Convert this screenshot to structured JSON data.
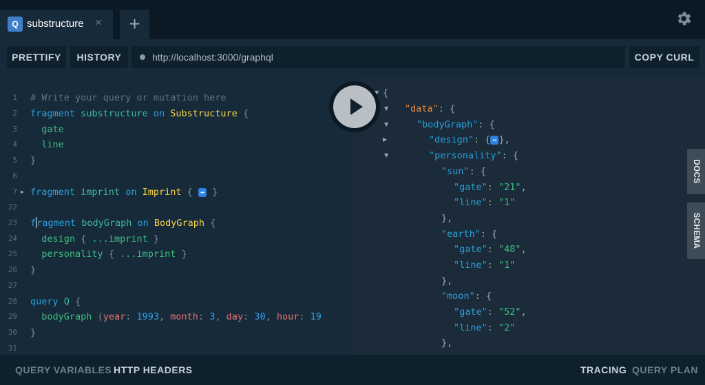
{
  "tab": {
    "badge": "Q",
    "title": "substructure",
    "close": "×",
    "add": "+"
  },
  "toolbar": {
    "prettify": "PRETTIFY",
    "history": "HISTORY",
    "url": "http://localhost:3000/graphql",
    "copy_curl": "COPY CURL"
  },
  "editor": {
    "line_numbers": [
      "1",
      "2",
      "3",
      "4",
      "5",
      "6",
      "7",
      "22",
      "23",
      "24",
      "25",
      "26",
      "27",
      "28",
      "29",
      "30",
      "31"
    ],
    "comment": "# Write your query or mutation here",
    "kw_fragment": "fragment",
    "kw_on": "on",
    "kw_query": "query",
    "frag1_name": "substructure",
    "frag1_type": "Substructure",
    "field_gate": "gate",
    "field_line": "line",
    "frag2_name": "imprint",
    "frag2_type": "Imprint",
    "collapsed": "↔",
    "frag3_name": "bodyGraph",
    "frag3_type": "BodyGraph",
    "field_design": "design",
    "field_personality": "personality",
    "spread": "...imprint",
    "query_name": "Q",
    "field_bodygraph": "bodyGraph",
    "arg_year": "year",
    "val_year": "1993",
    "arg_month": "month",
    "val_month": "3",
    "arg_day": "day",
    "val_day": "30",
    "arg_hour": "hour",
    "val_hour": "19"
  },
  "result": {
    "k_data": "\"data\"",
    "k_bodygraph": "\"bodyGraph\"",
    "k_design": "\"design\"",
    "k_personality": "\"personality\"",
    "k_sun": "\"sun\"",
    "k_earth": "\"earth\"",
    "k_moon": "\"moon\"",
    "k_gate": "\"gate\"",
    "k_line": "\"line\"",
    "v_sun_gate": "\"21\"",
    "v_sun_line": "\"1\"",
    "v_earth_gate": "\"48\"",
    "v_earth_line": "\"1\"",
    "v_moon_gate": "\"52\"",
    "v_moon_line": "\"2\""
  },
  "side": {
    "docs": "DOCS",
    "schema": "SCHEMA"
  },
  "bottom": {
    "query_variables": "QUERY VARIABLES",
    "http_headers": "HTTP HEADERS",
    "tracing": "TRACING",
    "query_plan": "QUERY PLAN"
  },
  "icons": {
    "settings": "gear-icon",
    "execute": "play-icon",
    "status": "dot-icon"
  },
  "colors": {
    "accent": "#2f83e0",
    "keyword": "#2a9fd9",
    "type": "#f5d547",
    "field": "#3dbe7f",
    "argument": "#e8716d"
  }
}
